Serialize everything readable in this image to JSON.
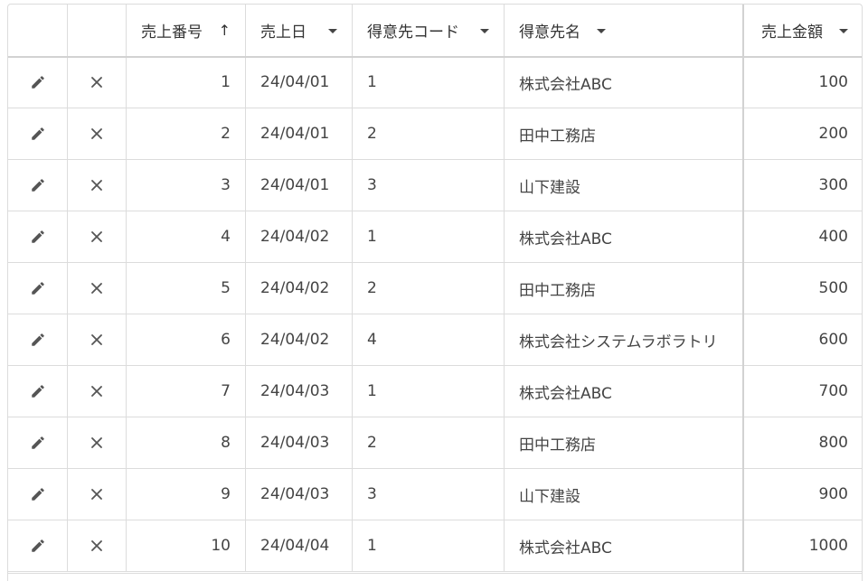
{
  "grid": {
    "columns": {
      "edit": "",
      "delete": "",
      "sales_no": "売上番号",
      "sales_date": "売上日",
      "customer_code": "得意先コード",
      "customer_name": "得意先名",
      "amount": "売上金額"
    },
    "sort": {
      "column": "sales_no",
      "direction": "asc",
      "icon": "arrow-up-icon"
    },
    "filter_icon": "caret-down-icon",
    "row_icons": {
      "edit": "pencil-icon",
      "delete": "close-icon"
    },
    "rows": [
      {
        "sales_no": "1",
        "sales_date": "24/04/01",
        "customer_code": "1",
        "customer_name": "株式会社ABC",
        "amount": "100"
      },
      {
        "sales_no": "2",
        "sales_date": "24/04/01",
        "customer_code": "2",
        "customer_name": "田中工務店",
        "amount": "200"
      },
      {
        "sales_no": "3",
        "sales_date": "24/04/01",
        "customer_code": "3",
        "customer_name": "山下建設",
        "amount": "300"
      },
      {
        "sales_no": "4",
        "sales_date": "24/04/02",
        "customer_code": "1",
        "customer_name": "株式会社ABC",
        "amount": "400"
      },
      {
        "sales_no": "5",
        "sales_date": "24/04/02",
        "customer_code": "2",
        "customer_name": "田中工務店",
        "amount": "500"
      },
      {
        "sales_no": "6",
        "sales_date": "24/04/02",
        "customer_code": "4",
        "customer_name": "株式会社システムラボラトリ",
        "amount": "600"
      },
      {
        "sales_no": "7",
        "sales_date": "24/04/03",
        "customer_code": "1",
        "customer_name": "株式会社ABC",
        "amount": "700"
      },
      {
        "sales_no": "8",
        "sales_date": "24/04/03",
        "customer_code": "2",
        "customer_name": "田中工務店",
        "amount": "800"
      },
      {
        "sales_no": "9",
        "sales_date": "24/04/03",
        "customer_code": "3",
        "customer_name": "山下建設",
        "amount": "900"
      },
      {
        "sales_no": "10",
        "sales_date": "24/04/04",
        "customer_code": "1",
        "customer_name": "株式会社ABC",
        "amount": "1000"
      }
    ]
  },
  "colors": {
    "border": "#dcdcdc",
    "date_text": "#1f4e8c",
    "icon": "#555555",
    "text": "#444444"
  }
}
